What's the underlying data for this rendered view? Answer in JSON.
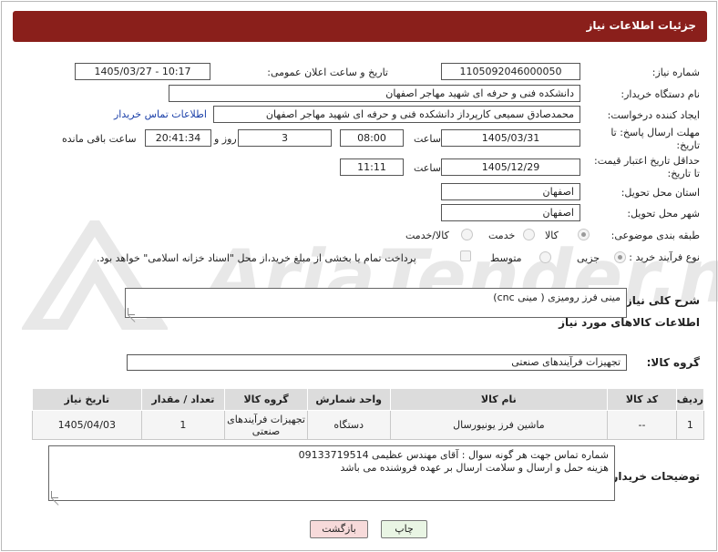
{
  "header": {
    "title": "جزئیات اطلاعات نیاز"
  },
  "need_number": {
    "label": "شماره نیاز:",
    "value": "1105092046000050"
  },
  "announce_datetime": {
    "label": "تاریخ و ساعت اعلان عمومی:",
    "value": "1405/03/27 - 10:17"
  },
  "buyer_org": {
    "label": "نام دستگاه خریدار:",
    "value": "دانشکده فنی و حرفه ای شهید مهاجر اصفهان"
  },
  "requester": {
    "label": "ایجاد کننده درخواست:",
    "value": "محمدصادق سمیعی کارپرداز دانشکده فنی و حرفه ای شهید مهاجر اصفهان",
    "contact_link": "اطلاعات تماس خریدار"
  },
  "response_deadline": {
    "label_line1": "مهلت ارسال پاسخ: تا",
    "label_line2": "تاریخ:",
    "date": "1405/03/31",
    "time_label": "ساعت",
    "time": "08:00",
    "days": "3",
    "days_label": "روز و",
    "remaining": "20:41:34",
    "remaining_label": "ساعت باقی مانده"
  },
  "price_validity": {
    "label_line1": "حداقل تاریخ اعتبار قیمت:",
    "label_line2": "تا تاریخ:",
    "date": "1405/12/29",
    "time_label": "ساعت",
    "time": "11:11"
  },
  "delivery_province": {
    "label": "استان محل تحویل:",
    "value": "اصفهان"
  },
  "delivery_city": {
    "label": "شهر محل تحویل:",
    "value": "اصفهان"
  },
  "category": {
    "label": "طبقه بندی موضوعی:",
    "options": [
      "کالا",
      "خدمت",
      "کالا/خدمت"
    ],
    "selected": "کالا"
  },
  "process_type": {
    "label": "نوع فرآیند خرید :",
    "options": [
      "جزیی",
      "متوسط"
    ],
    "selected": "جزیی",
    "payment_note": "پرداخت تمام یا بخشی از مبلغ خرید،از محل \"اسناد خزانه اسلامی\" خواهد بود."
  },
  "description": {
    "label": "شرح کلی نیاز:",
    "value": "مینی فرز رومیزی ( مینی cnc)"
  },
  "goods_info": {
    "title": "اطلاعات کالاهای مورد نیاز"
  },
  "goods_group": {
    "label": "گروه کالا:",
    "value": "تجهیزات فرآیندهای صنعتی"
  },
  "table": {
    "headers": [
      "ردیف",
      "کد کالا",
      "نام کالا",
      "واحد شمارش",
      "گروه کالا",
      "تعداد / مقدار",
      "تاریخ نیاز"
    ],
    "rows": [
      [
        "1",
        "--",
        "ماشین فرز یونیورسال",
        "دستگاه",
        "تجهیزات فرآیندهای صنعتی",
        "1",
        "1405/04/03"
      ]
    ]
  },
  "buyer_notes": {
    "label": "توضیحات خریدار:",
    "line1": "شماره تماس جهت هر گونه سوال : آقای مهندس عظیمی 09133719514",
    "line2": "هزینه حمل و ارسال و سلامت ارسال بر عهده فروشنده می باشد"
  },
  "buttons": {
    "print": "چاپ",
    "back": "بازگشت"
  },
  "watermark": {
    "text": "AriaTender.net"
  },
  "colors": {
    "header_bg": "#8a1f1b",
    "link": "#1a3fa8",
    "back_button_bg": "#f7dada",
    "print_button_bg": "#e9f5e4"
  }
}
